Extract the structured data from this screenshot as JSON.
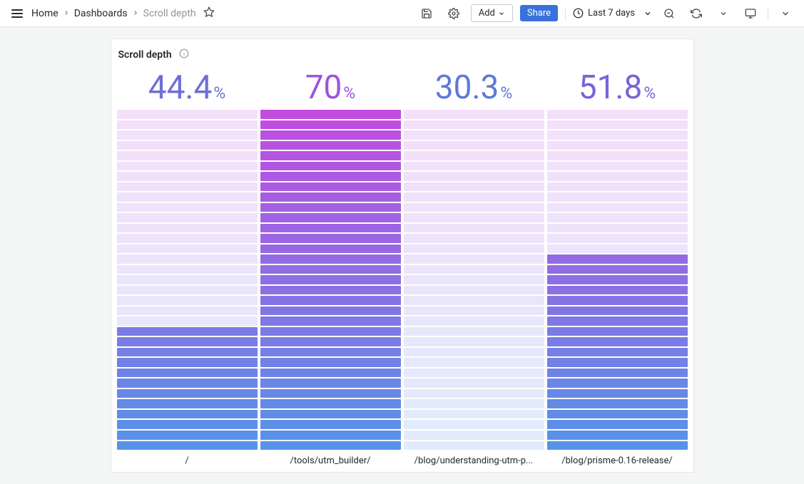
{
  "header": {
    "breadcrumbs": [
      {
        "label": "Home"
      },
      {
        "label": "Dashboards"
      }
    ],
    "current": "Scroll depth",
    "add_label": "Add",
    "share_label": "Share",
    "time_range": "Last 7 days"
  },
  "panel": {
    "title": "Scroll depth"
  },
  "chart_data": {
    "type": "heatmap",
    "title": "Scroll depth",
    "ylim": [
      0,
      100
    ],
    "rows": 33,
    "gradient": {
      "top": "#c24be0",
      "bottom": "#5793e8"
    },
    "series": [
      {
        "label": "/",
        "value": 44.4,
        "unit": "%",
        "stat_color": "#6D6FD7",
        "threshold_row": 21
      },
      {
        "label": "/tools/utm_builder/",
        "value": 70,
        "unit": "%",
        "stat_color": "#9D53DE",
        "threshold_row": 0
      },
      {
        "label": "/blog/understanding-utm-p...",
        "value": 30.3,
        "unit": "%",
        "stat_color": "#5E78DA",
        "threshold_row": 33
      },
      {
        "label": "/blog/prisme-0.16-release/",
        "value": 51.8,
        "unit": "%",
        "stat_color": "#7964D9",
        "threshold_row": 14
      }
    ]
  }
}
